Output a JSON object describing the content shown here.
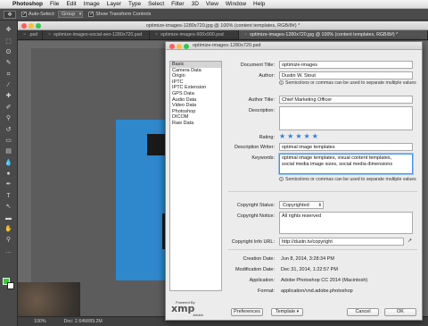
{
  "menubar": {
    "app": "Photoshop",
    "items": [
      "File",
      "Edit",
      "Image",
      "Layer",
      "Type",
      "Select",
      "Filter",
      "3D",
      "View",
      "Window",
      "Help"
    ]
  },
  "options": {
    "auto_select_label": "Auto-Select:",
    "auto_select_value": "Group",
    "transform_label": "Show Transform Controls"
  },
  "window_title": "optimize-images-1280x720.jpg @ 100% (content templates, RGB/8#) *",
  "tabs": [
    ".psd",
    "optimize-images-social-seo-1280x720.psd",
    "optimize-images-900x900.psd",
    "optimize-images-1280x720.jpg @ 100% (content templates, RGB/8#) *"
  ],
  "status": {
    "zoom": "100%",
    "doc": "Doc: 2.64M/89.2M"
  },
  "dialog": {
    "title": "optimize-images-1280x720.psd",
    "categories": [
      "Basic",
      "Camera Data",
      "Origin",
      "IPTC",
      "IPTC Extension",
      "GPS Data",
      "Audio Data",
      "Video Data",
      "Photoshop",
      "DICOM",
      "Raw Data"
    ],
    "selected_category": "Basic",
    "labels": {
      "doc_title": "Document Title:",
      "author": "Author:",
      "author_title": "Author Title:",
      "description": "Description:",
      "rating": "Rating:",
      "desc_writer": "Description Writer:",
      "keywords": "Keywords:",
      "copyright_status": "Copyright Status:",
      "copyright_notice": "Copyright Notice:",
      "copyright_url": "Copyright Info URL:",
      "creation_date": "Creation Date:",
      "modification_date": "Modification Date:",
      "application": "Application:",
      "format": "Format:"
    },
    "values": {
      "doc_title": "optimize-images",
      "author": "Dustin W. Stout",
      "author_title": "Chief Marketing Officer",
      "description": "",
      "rating": 5,
      "desc_writer": "optimal image templates",
      "keywords": "optimal image templates, visual content templates,\nsocial media image sizes, social media dimensions",
      "copyright_status": "Copyrighted",
      "copyright_notice": "All rights reserved",
      "copyright_url": "http://dustn.tv/copyright",
      "creation_date": "Jun 8, 2014, 3:28:34 PM",
      "modification_date": "Dec 31, 2014, 1:22:57 PM",
      "application": "Adobe Photoshop CC 2014 (Macintosh)",
      "format": "application/vnd.adobe.photoshop"
    },
    "notes": {
      "author_note": "Semicolons or commas can be used to separate multiple values",
      "keywords_note": "Semicolons or commas can be used to separate multiple values"
    },
    "logo": {
      "powered": "Powered By",
      "xmp": "xmp",
      "adobe": "Adobe"
    },
    "buttons": {
      "preferences": "Preferences",
      "template": "Template",
      "cancel": "Cancel",
      "ok": "OK"
    }
  }
}
